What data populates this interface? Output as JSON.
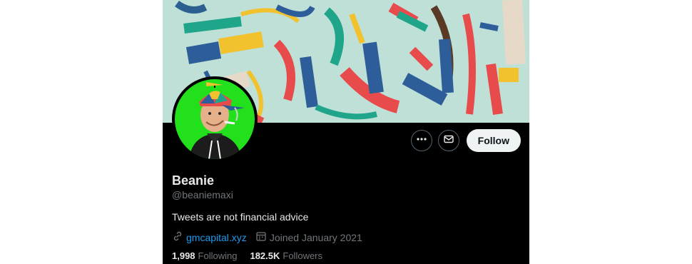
{
  "profile": {
    "name": "Beanie",
    "handle": "@beaniemaxi",
    "bio": "Tweets are not financial advice",
    "website": "gmcapital.xyz",
    "joined": "Joined January 2021",
    "following_count": "1,998",
    "following_label": "Following",
    "followers_count": "182.5K",
    "followers_label": "Followers"
  },
  "actions": {
    "more_icon": "more-horizontal-icon",
    "message_icon": "envelope-icon",
    "follow_label": "Follow"
  },
  "colors": {
    "background": "#000000",
    "link": "#1d9bf0",
    "muted_text": "#71767b",
    "primary_text": "#e7e9ea",
    "follow_button_bg": "#eff3f4",
    "avatar_bg": "#22e11c",
    "banner_bg": "#bfe0d7"
  }
}
